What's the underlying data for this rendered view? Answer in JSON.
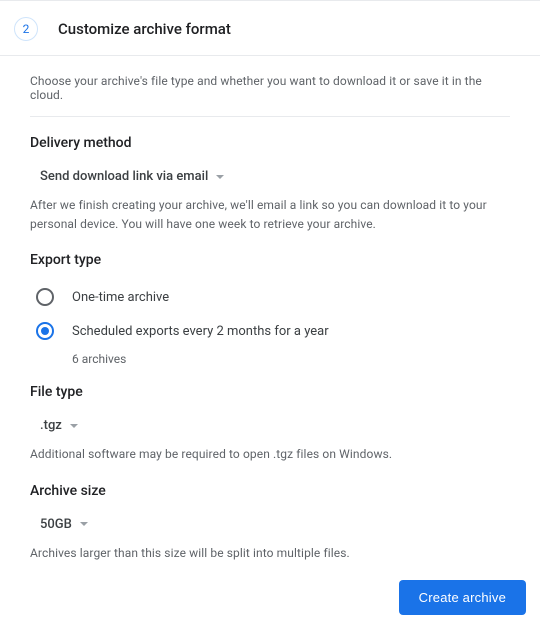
{
  "header": {
    "step_number": "2",
    "title": "Customize archive format"
  },
  "intro": "Choose your archive's file type and whether you want to download it or save it in the cloud.",
  "delivery": {
    "title": "Delivery method",
    "selected": "Send download link via email",
    "help": "After we finish creating your archive, we'll email a link so you can download it to your personal device. You will have one week to retrieve your archive."
  },
  "export_type": {
    "title": "Export type",
    "options": [
      {
        "label": "One-time archive",
        "selected": false
      },
      {
        "label": "Scheduled exports every 2 months for a year",
        "selected": true,
        "sub": "6 archives"
      }
    ]
  },
  "file_type": {
    "title": "File type",
    "selected": ".tgz",
    "help": "Additional software may be required to open .tgz files on Windows."
  },
  "archive_size": {
    "title": "Archive size",
    "selected": "50GB",
    "help": "Archives larger than this size will be split into multiple files."
  },
  "footer": {
    "create_label": "Create archive"
  }
}
